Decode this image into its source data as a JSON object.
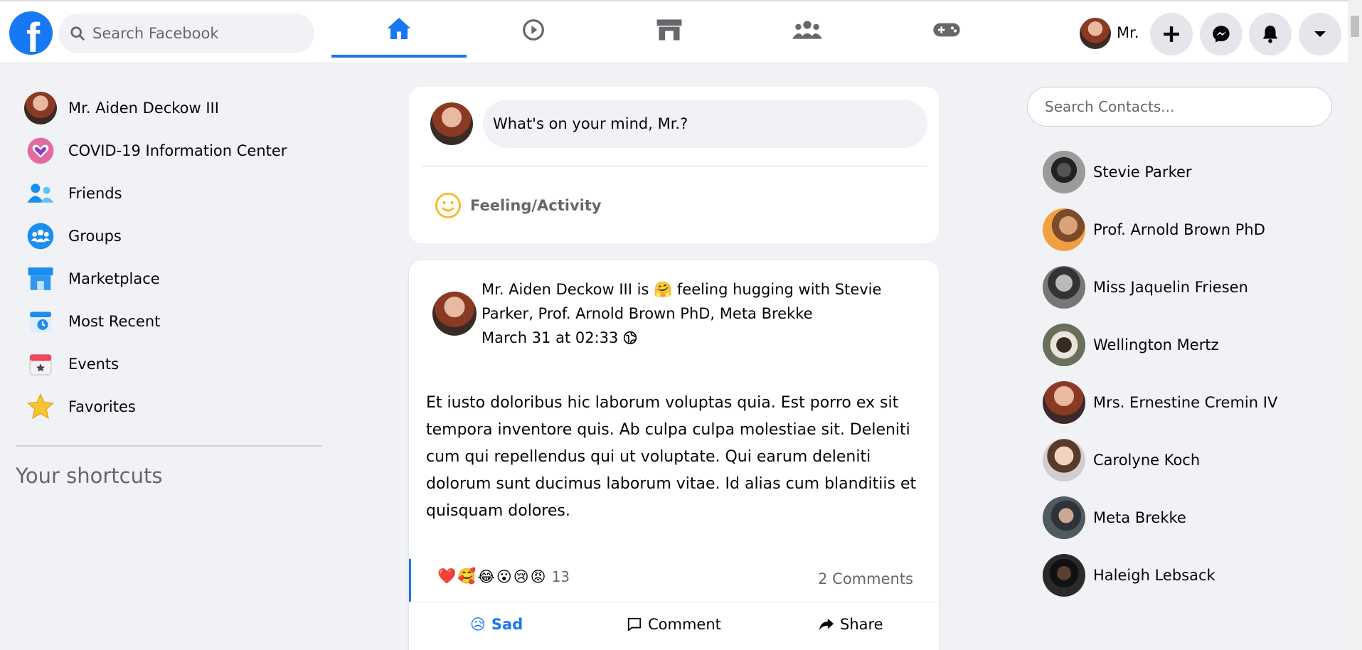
{
  "topbar": {
    "logo_letter": "f",
    "search_placeholder": "Search Facebook",
    "user_short_name": "Mr.",
    "nav_tabs": [
      "home",
      "watch",
      "marketplace",
      "groups",
      "gaming"
    ],
    "icons": {
      "create": "plus-icon",
      "messenger": "messenger-icon",
      "notifications": "bell-icon",
      "account": "chevron-down-icon"
    }
  },
  "sidebar": {
    "items": [
      {
        "label": "Mr. Aiden Deckow III",
        "icon": "avatar"
      },
      {
        "label": "COVID-19 Information Center",
        "icon": "covid-heart-icon"
      },
      {
        "label": "Friends",
        "icon": "friends-icon"
      },
      {
        "label": "Groups",
        "icon": "groups-icon"
      },
      {
        "label": "Marketplace",
        "icon": "marketplace-icon"
      },
      {
        "label": "Most Recent",
        "icon": "most-recent-icon"
      },
      {
        "label": "Events",
        "icon": "events-icon"
      },
      {
        "label": "Favorites",
        "icon": "star-icon"
      }
    ],
    "shortcuts_title": "Your shortcuts"
  },
  "create_post": {
    "placeholder": "What's on your mind, Mr.?",
    "feeling_label": "Feeling/Activity"
  },
  "post": {
    "header_line": "Mr. Aiden Deckow III is 🤗 feeling hugging with Stevie Parker, Prof. Arnold Brown PhD, Meta Brekke",
    "timestamp": "March 31 at 02:33",
    "privacy_icon": "globe-icon",
    "body": "Et iusto doloribus hic laborum voluptas quia. Est porro ex sit tempora inventore quis. Ab culpa culpa molestiae sit. Deleniti cum qui repellendus qui ut voluptate. Qui earum deleniti dolorum sunt ducimus laborum vitae. Id alias cum blanditiis et quisquam dolores.",
    "reaction_emojis": [
      "❤️",
      "🥰",
      "😂",
      "😮",
      "😢",
      "😡"
    ],
    "reaction_count": "13",
    "comments_count": "2 Comments",
    "actions": {
      "sad_label": "Sad",
      "sad_emoji": "😥",
      "comment_label": "Comment",
      "share_label": "Share"
    }
  },
  "contacts": {
    "search_placeholder": "Search Contacts...",
    "items": [
      "Stevie Parker",
      "Prof. Arnold Brown PhD",
      "Miss Jaquelin Friesen",
      "Wellington Mertz",
      "Mrs. Ernestine Cremin IV",
      "Carolyne Koch",
      "Meta Brekke",
      "Haleigh Lebsack"
    ]
  },
  "colors": {
    "brand": "#1877f2",
    "background": "#f0f2f5",
    "secondary_text": "#65676b"
  }
}
